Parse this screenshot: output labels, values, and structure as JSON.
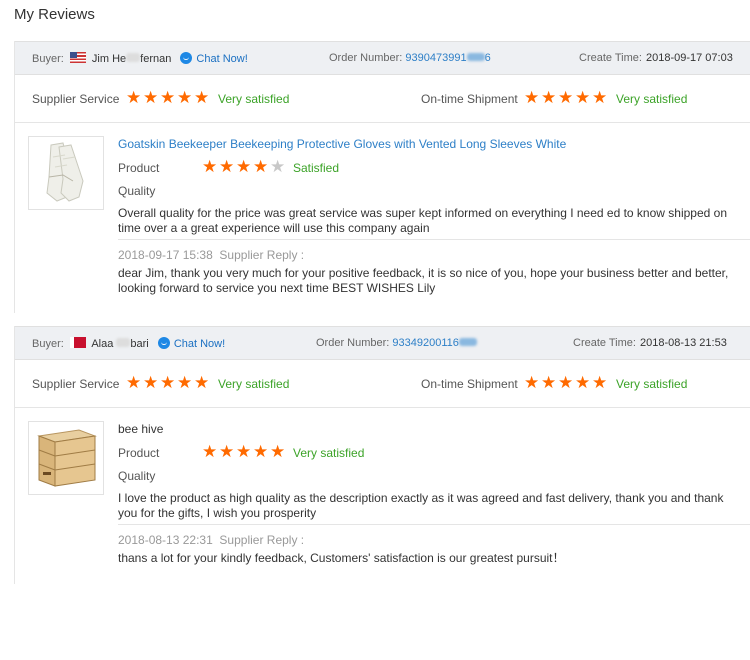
{
  "page": {
    "title": "My Reviews"
  },
  "colors": {
    "accent": "#ff6a00",
    "link": "#2d7fc7",
    "positive": "#3ca328",
    "header_bg": "#eef0f3"
  },
  "reviews": [
    {
      "buyer_label": "Buyer:",
      "buyer_name": "Jim He",
      "buyer_name_tail": "fernan",
      "chat_label": "Chat Now!",
      "order_label": "Order Number:",
      "order_number": "9390473991",
      "order_number_tail": "6",
      "time_label": "Create Time:",
      "create_time": "2018-09-17 07:03",
      "supplier_service_label": "Supplier Service",
      "supplier_service_rating": 5,
      "supplier_service_text": "Very satisfied",
      "shipment_label": "On-time Shipment",
      "shipment_rating": 5,
      "shipment_text": "Very satisfied",
      "product_title": "Goatskin Beekeeper Beekeeping Protective Gloves with Vented Long Sleeves White",
      "product_label": "Product",
      "product_rating": 4,
      "product_text": "Satisfied",
      "quality_label": "Quality",
      "comment": "Overall quality for the price was great service was super kept informed on everything I need ed to know shipped on time over a a great experience will use this company again",
      "reply_time": "2018-09-17 15:38",
      "reply_label": "Supplier Reply :",
      "reply_text": "dear Jim, thank you very much for your positive feedback, it is so nice of you, hope your business better and better, looking forward to service you next time BEST WISHES Lily"
    },
    {
      "buyer_label": "Buyer:",
      "buyer_name": "Alaa",
      "buyer_name_tail": "bari",
      "chat_label": "Chat Now!",
      "order_label": "Order Number:",
      "order_number": "93349200116",
      "order_number_tail": "",
      "time_label": "Create Time:",
      "create_time": "2018-08-13 21:53",
      "supplier_service_label": "Supplier Service",
      "supplier_service_rating": 5,
      "supplier_service_text": "Very satisfied",
      "shipment_label": "On-time Shipment",
      "shipment_rating": 5,
      "shipment_text": "Very satisfied",
      "product_title": "bee hive",
      "product_label": "Product",
      "product_rating": 5,
      "product_text": "Very satisfied",
      "quality_label": "Quality",
      "comment": "I love the product as high quality as the description exactly as it was agreed and fast delivery, thank you and thank you for the gifts, I wish you prosperity",
      "reply_time": "2018-08-13 22:31",
      "reply_label": "Supplier Reply :",
      "reply_text": "thans a lot for your kindly feedback, Customers' satisfaction is our greatest pursuit！"
    }
  ]
}
